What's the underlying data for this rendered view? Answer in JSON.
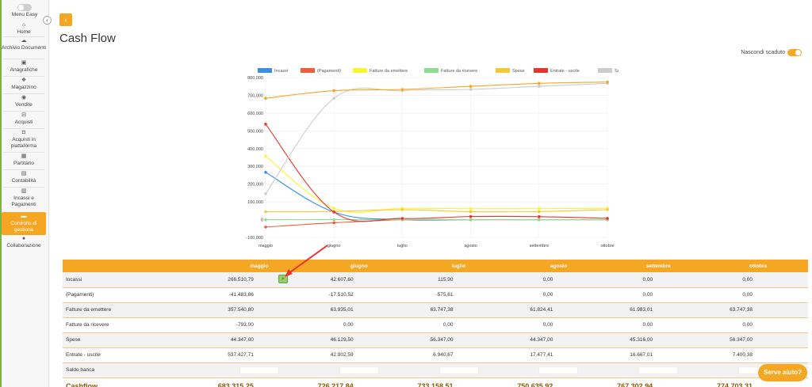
{
  "sidebar": {
    "menu_label": "Menu Easy",
    "collapse_icon": "chevron-left-icon",
    "items": [
      {
        "label": "Home",
        "icon": "home-icon",
        "glyph": "⌂"
      },
      {
        "label": "Archivio Documenti",
        "icon": "cloud-icon",
        "glyph": "☁"
      },
      {
        "label": "Anagrafiche",
        "icon": "id-card-icon",
        "glyph": "▣"
      },
      {
        "label": "Magazzino",
        "icon": "boxes-icon",
        "glyph": "❖"
      },
      {
        "label": "Vendite",
        "icon": "eye-icon",
        "glyph": "◉"
      },
      {
        "label": "Acquisti",
        "icon": "basket-icon",
        "glyph": "⊟"
      },
      {
        "label": "Acquisti in piattaforma",
        "icon": "bag-icon",
        "glyph": "◘"
      },
      {
        "label": "Partitario",
        "icon": "grid-icon",
        "glyph": "▦"
      },
      {
        "label": "Contabilità",
        "icon": "book-icon",
        "glyph": "▤"
      },
      {
        "label": "Incassi e Pagamenti",
        "icon": "calendar-icon",
        "glyph": "▥"
      },
      {
        "label": "Controllo di gestione",
        "icon": "wallet-icon",
        "glyph": "▬"
      },
      {
        "label": "Collaborazione",
        "icon": "chat-icon",
        "glyph": "●"
      }
    ]
  },
  "header": {
    "back_icon": "chevron-left-icon",
    "title": "Cash Flow",
    "hide_expired_label": "Nascondi scaduto",
    "hide_expired_on": true
  },
  "chart_data": {
    "type": "line",
    "categories": [
      "maggio",
      "giugno",
      "luglio",
      "agosto",
      "settembre",
      "ottobre"
    ],
    "ylim": [
      -100000,
      800000
    ],
    "yticks": [
      -100000,
      0,
      100000,
      200000,
      300000,
      400000,
      500000,
      600000,
      700000,
      800000
    ],
    "ytick_labels": [
      "-100,000",
      "0",
      "100,000",
      "200,000",
      "300,000",
      "400,000",
      "500,000",
      "600,000",
      "700,000",
      "800,000"
    ],
    "grid": true,
    "legend_position": "top",
    "series": [
      {
        "name": "Incassi",
        "color": "#3a8ee6",
        "values": [
          266510.79,
          42607.6,
          115.9,
          0,
          0,
          0
        ]
      },
      {
        "name": "(Pagamenti)",
        "color": "#f25c3a",
        "values": [
          -41483.86,
          -17510.52,
          -575.61,
          0,
          0,
          0
        ]
      },
      {
        "name": "Fatture da emettere",
        "color": "#f9f62a",
        "values": [
          357540.8,
          63935.01,
          63747.38,
          61824.41,
          61983.01,
          63747.38
        ]
      },
      {
        "name": "Fatture da ricevere",
        "color": "#8fdc8f",
        "values": [
          -793.0,
          0,
          0,
          0,
          0,
          0
        ]
      },
      {
        "name": "Spese",
        "color": "#f7c836",
        "values": [
          44347.0,
          46129.5,
          56347.0,
          44347.0,
          45316.0,
          56347.0
        ]
      },
      {
        "name": "Entrate - uscite",
        "color": "#e8342b",
        "values": [
          537427.71,
          42902.59,
          6940.67,
          17477.41,
          16667.01,
          7400.38
        ]
      },
      {
        "name": "Saldo banca",
        "color": "#cccccc",
        "values": [
          145887.54,
          683315.25,
          726217.84,
          733158.51,
          750635.92,
          767302.94
        ]
      },
      {
        "name": "Cashflow",
        "color": "#f5a623",
        "values": [
          683315.25,
          726217.84,
          733158.51,
          750635.92,
          767302.94,
          774703.31
        ]
      }
    ]
  },
  "table": {
    "columns": [
      "maggio",
      "giugno",
      "luglio",
      "agosto",
      "settembre",
      "ottobre"
    ],
    "rows": [
      {
        "label": "Incassi",
        "values": [
          "266.510,79",
          "42.607,60",
          "115,90",
          "0,00",
          "0,00",
          "0,00"
        ]
      },
      {
        "label": "(Pagamenti)",
        "values": [
          "-41.483,86",
          "-17.510,52",
          "-575,61",
          "0,00",
          "0,00",
          "0,00"
        ]
      },
      {
        "label": "Fatture da emettere",
        "values": [
          "357.540,80",
          "63.935,01",
          "63.747,38",
          "61.824,41",
          "61.983,01",
          "63.747,38"
        ]
      },
      {
        "label": "Fatture da ricevere",
        "values": [
          "-793,00",
          "0,00",
          "0,00",
          "0,00",
          "0,00",
          "0,00"
        ]
      },
      {
        "label": "Spese",
        "values": [
          "44.347,00",
          "46.129,50",
          "56.347,00",
          "44.347,00",
          "45.316,00",
          "56.347,00"
        ]
      },
      {
        "label": "Entrate - uscite",
        "values": [
          "537.427,71",
          "42.902,59",
          "6.940,67",
          "17.477,41",
          "16.667,01",
          "7.400,38"
        ]
      }
    ],
    "bank_label": "Saldo banca",
    "cashflow_label": "Cashflow",
    "cashflow_values": [
      "683.315,25",
      "726.217,84",
      "733.158,51",
      "750.635,92",
      "767.302,94",
      "774.703,31"
    ]
  },
  "search_icon": "magnifier-icon",
  "help_label": "Serve aiuto?",
  "colors": {
    "accent": "#f5a623",
    "green": "#7cb342"
  }
}
